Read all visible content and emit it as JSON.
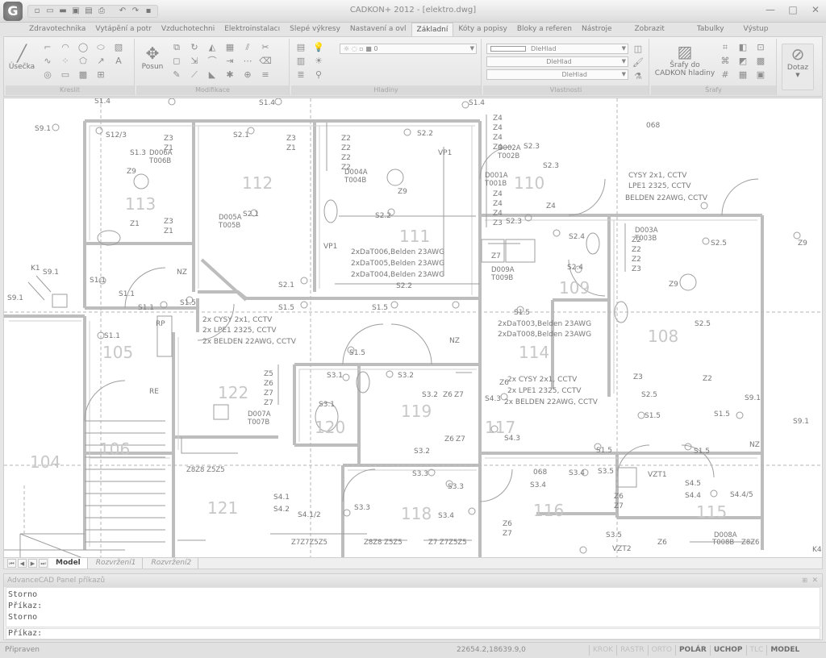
{
  "window": {
    "title": "CADKON+ 2012 - [elektro.dwg]",
    "logo": "G",
    "qat_icons": [
      "new-file-icon",
      "open-file-icon",
      "open-folder-icon",
      "save-icon",
      "save-as-icon",
      "print-icon",
      "undo-icon",
      "redo-icon",
      "lock-icon"
    ],
    "minimize": "—",
    "maximize": "□",
    "close": "✕"
  },
  "ribbon": {
    "tabs": [
      {
        "label": "Zdravotechnika",
        "active": false
      },
      {
        "label": "Vytápění a potr",
        "active": false
      },
      {
        "label": "Vzduchotechni",
        "active": false
      },
      {
        "label": "Elektroinstalacı",
        "active": false
      },
      {
        "label": "Slepé výkresy",
        "active": false
      },
      {
        "label": "Nastavení a ovl",
        "active": false
      },
      {
        "label": "Základní",
        "active": true
      },
      {
        "label": "Kóty a popisy",
        "active": false
      },
      {
        "label": "Bloky a referen",
        "active": false
      },
      {
        "label": "Nástroje",
        "active": false
      },
      {
        "label": "Zobrazit",
        "active": false
      },
      {
        "label": "Tabulky",
        "active": false
      },
      {
        "label": "Výstup",
        "active": false
      }
    ],
    "panels": {
      "kresli": {
        "title": "Kreslit",
        "big_button": "Úsečka"
      },
      "modifikace": {
        "title": "Modifikace",
        "big_button": "Posun"
      },
      "hladiny": {
        "title": "Hladiny",
        "layer_value": "0"
      },
      "vlastnosti": {
        "title": "Vlastnosti",
        "color_value": "DleHlad",
        "linetype_value": "DleHlad",
        "lineweight_value": "DleHlad"
      },
      "srafy": {
        "title": "Šrafy",
        "big_button_line1": "Šrafy do",
        "big_button_line2": "CADKON hladiny"
      },
      "dotaz": {
        "big_button": "Dotaz"
      }
    }
  },
  "drawing": {
    "rooms": [
      "113",
      "112",
      "111",
      "110",
      "109",
      "108",
      "105",
      "114",
      "122",
      "120",
      "119",
      "117",
      "106",
      "104",
      "121",
      "118",
      "116",
      "115"
    ],
    "labels": {
      "s14a": "S1.4",
      "s14b": "S1.4",
      "s14c": "S1.4",
      "s91a": "S9.1",
      "s123": "S12/3",
      "s13": "S1.3",
      "d006a": "D006A",
      "t006b": "T006B",
      "z9a": "Z9",
      "z3a": "Z3",
      "z1a": "Z1",
      "z3b": "Z3",
      "z1b": "Z1",
      "z1c": "Z1",
      "s21a": "S2.1",
      "z3c": "Z3",
      "z1d": "Z1",
      "z2a": "Z2",
      "z2b": "Z2",
      "z2c": "Z2",
      "z2d": "Z2",
      "d004a": "D004A",
      "t004b": "T004B",
      "z9b": "Z9",
      "s22a": "S2.2",
      "vp1a": "VP1",
      "s22b": "S2.2",
      "d005a": "D005A",
      "t005b": "T005B",
      "s21b": "S2.1",
      "vp1b": "VP1",
      "cab1": "2xDaT006,Belden 23AWG",
      "cab2": "2xDaT005,Belden 23AWG",
      "cab3": "2xDaT004,Belden 23AWG",
      "s21c": "S2.1",
      "s22c": "S2.2",
      "z4a": "Z4",
      "z4b": "Z4",
      "z4c": "Z4",
      "z4d": "Z4",
      "z4e": "Z4",
      "z4f": "Z4",
      "z4g": "Z4",
      "z3d": "Z3",
      "d002a": "D002A",
      "t002b": "T002B",
      "s23a": "S2.3",
      "s23b": "S2.3",
      "d001a": "D001A",
      "t001b": "T001B",
      "s23c": "S2.3",
      "z7": "Z7",
      "d009a": "D009A",
      "t009b": "T009B",
      "o68a": "068",
      "cctv1": "CYSY 2x1, CCTV",
      "cctv2": "LPE1 2325, CCTV",
      "cctv3": "BELDEN 22AWG, CCTV",
      "z4h": "Z4",
      "s24a": "S2.4",
      "d003a": "D003A",
      "t003b": "T003B",
      "z2e": "Z2",
      "z2f": "Z2",
      "z2g": "Z2",
      "z3e": "Z3",
      "s25a": "S2.5",
      "z9c": "Z9",
      "s24b": "S2.4",
      "z9d": "Z9",
      "s25b": "S2.5",
      "k1": "K1",
      "s91b": "S9.1",
      "s91c": "S9.1",
      "s11a": "S1.1",
      "s11b": "S1.1",
      "nz1": "NZ",
      "s11c": "S1.1",
      "s15a": "S1.5",
      "rp": "RP",
      "cab4": "2x CYSY 2x1, CCTV",
      "cab5": "2x LPE1 2325, CCTV",
      "cab6": "2x BELDEN 22AWG, CCTV",
      "s15b": "S1.5",
      "s15c": "S1.5",
      "s11d": "S1.1",
      "s15d": "S1.5",
      "cab7": "2xDaT003,Belden 23AWG",
      "cab8": "2xDaT008,Belden 23AWG",
      "nz2": "NZ",
      "s15e": "S1.5",
      "re": "RE",
      "z5": "Z5",
      "z6a": "Z6",
      "z7b": "Z7",
      "z7c": "Z7",
      "s31a": "S3.1",
      "s32a": "S3.2",
      "s32b": "S3.2",
      "z6b": "Z6",
      "z7d": "Z7",
      "z6c": "Z6",
      "cab9": "2x CYSY 2x1, CCTV",
      "cab10": "2x LPE1 2325, CCTV",
      "cab11": "2x BELDEN 22AWG, CCTV",
      "s43a": "S4.3",
      "z3f": "Z3",
      "z2h": "Z2",
      "s25c": "S2.5",
      "s91d": "S9.1",
      "d007a": "D007A",
      "t007b": "T007B",
      "s31b": "S3.1",
      "s15f": "S1.5",
      "s15g": "S1.5",
      "s15h": "S1.5",
      "s15i": "S1.5",
      "s91e": "S9.1",
      "nz3": "NZ",
      "z8z8z5z5a": "Z8Z8 Z5Z5",
      "z6d": "Z6",
      "z7e": "Z7",
      "s32c": "S3.2",
      "s43b": "S4.3",
      "s33a": "S3.3",
      "s33b": "S3.3",
      "s33c": "S3.3",
      "o68b": "068",
      "s34a": "S3.4",
      "s34b": "S3.4",
      "s35a": "S3.5",
      "vzt1": "VZT1",
      "s41": "S4.1",
      "s42": "S4.2",
      "s412": "S4.1/2",
      "s34c": "S3.4",
      "s45": "S4.5",
      "s44a": "S4.4",
      "s4445": "S4.4/5",
      "z6e": "Z6",
      "z7f": "Z7",
      "z6f": "Z6",
      "z7g": "Z7",
      "s35b": "S3.5",
      "vzt2": "VZT2",
      "z6g": "Z6",
      "d008a": "D008A",
      "t008b": "T008B",
      "z7z7z5z5": "Z7Z7Z5Z5",
      "z8z8z5z5b": "Z8Z8 Z5Z5",
      "z7z7z5z5b": "Z7 Z7Z5Z5",
      "z8z6": "Z8Z6",
      "k4": "K4"
    }
  },
  "layout_tabs": [
    {
      "label": "Model",
      "active": true
    },
    {
      "label": "Rozvržení1",
      "active": false
    },
    {
      "label": "Rozvržení2",
      "active": false
    }
  ],
  "command_panel": {
    "title": "AdvanceCAD Panel příkazů",
    "history": [
      "Storno",
      "Příkaz:",
      "Storno"
    ],
    "prompt": "Příkaz:",
    "input_value": ""
  },
  "status": {
    "text": "Připraven",
    "coords": "22654.2,18639.9,0",
    "toggles": [
      {
        "label": "KROK",
        "on": false
      },
      {
        "label": "RASTR",
        "on": false
      },
      {
        "label": "ORTO",
        "on": false
      },
      {
        "label": "POLÁR",
        "on": true
      },
      {
        "label": "UCHOP",
        "on": true
      },
      {
        "label": "TLC",
        "on": false
      },
      {
        "label": "MODEL",
        "on": true
      }
    ]
  }
}
